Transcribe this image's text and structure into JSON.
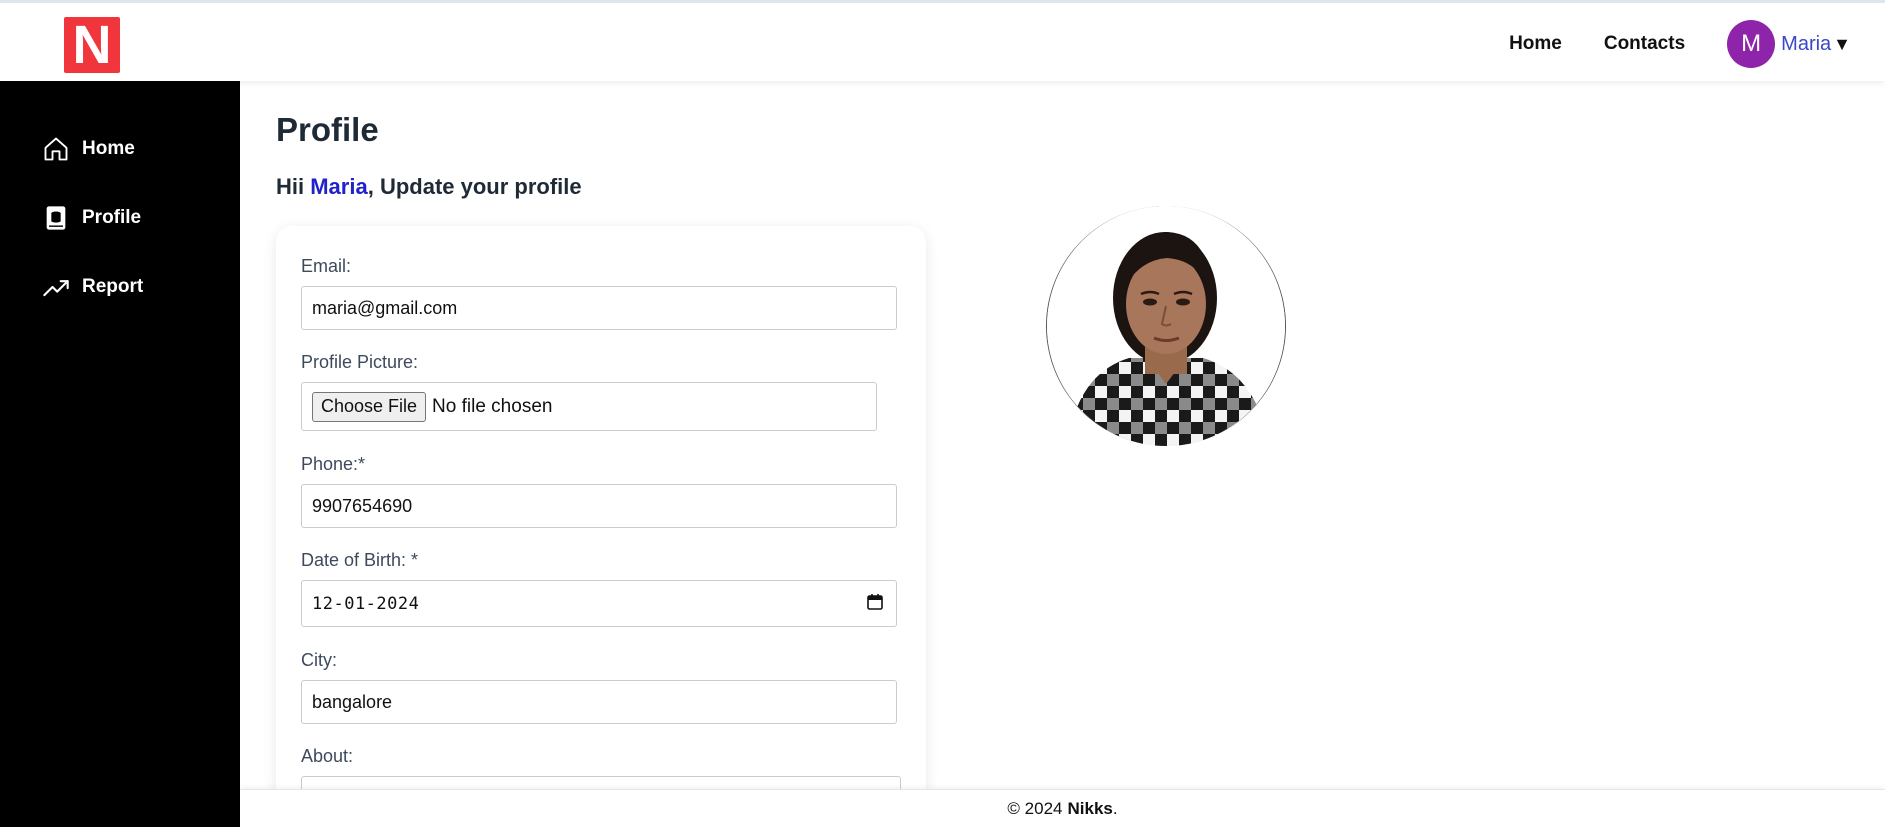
{
  "header": {
    "logo_letter": "N",
    "nav": {
      "home": "Home",
      "contacts": "Contacts"
    },
    "user": {
      "initial": "M",
      "name": "Maria",
      "caret": "▼"
    }
  },
  "sidebar": {
    "items": [
      {
        "label": "Home",
        "icon": "home-icon"
      },
      {
        "label": "Profile",
        "icon": "profile-book-icon"
      },
      {
        "label": "Report",
        "icon": "trend-up-icon"
      }
    ]
  },
  "main": {
    "title": "Profile",
    "greeting_prefix": "Hii ",
    "greeting_name": "Maria",
    "greeting_suffix": ", Update your profile",
    "form": {
      "email_label": "Email:",
      "email_value": "maria@gmail.com",
      "picture_label": "Profile Picture:",
      "file_button": "Choose File",
      "file_status": "No file chosen",
      "phone_label": "Phone:*",
      "phone_value": "9907654690",
      "dob_label": "Date of Birth: *",
      "dob_value": "12-01-2024",
      "city_label": "City:",
      "city_value": "bangalore",
      "about_label": "About:",
      "about_value": ""
    }
  },
  "footer": {
    "prefix": "© 2024",
    "brand": "Nikks",
    "suffix": "."
  },
  "colors": {
    "logo": "#f0353d",
    "avatar": "#8e24aa",
    "sidebar": "#000000",
    "highlight": "#2222cc"
  }
}
